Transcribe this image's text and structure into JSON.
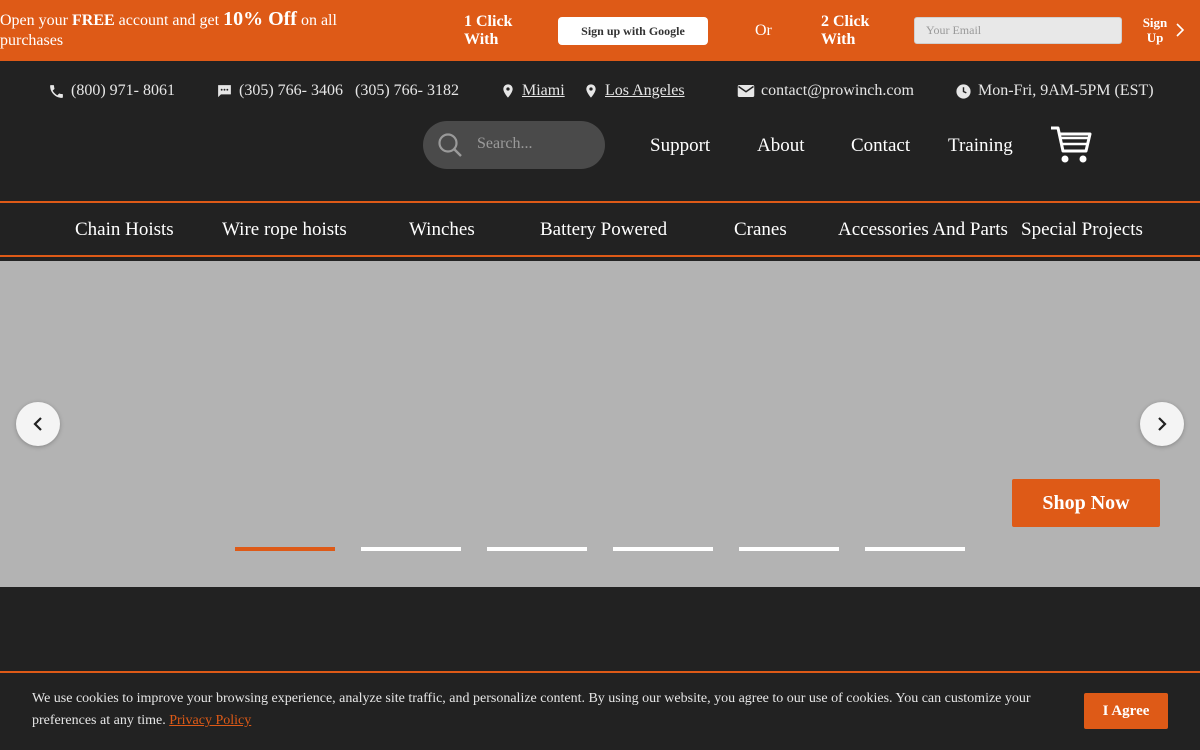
{
  "promo": {
    "text_prefix": "Open your ",
    "text_free": "FREE",
    "text_mid": " account and get ",
    "text_offer": "10% Off",
    "text_suffix": " on all purchases",
    "one_click": "1 Click With",
    "google_button": "Sign up with Google",
    "or": "Or",
    "two_click": "2 Click With",
    "email_placeholder": "Your Email",
    "signup": "Sign Up"
  },
  "contact": {
    "phone": "(800) 971- 8061",
    "chat_1": "(305) 766- 3406",
    "chat_2": "(305) 766- 3182",
    "location_1": "Miami",
    "location_2": "Los Angeles",
    "email": "contact@prowinch.com",
    "hours": "Mon-Fri, 9AM-5PM (EST)"
  },
  "header": {
    "search_placeholder": "Search...",
    "nav": [
      "Support",
      "About",
      "Contact",
      "Training"
    ]
  },
  "categories": [
    "Chain Hoists",
    "Wire rope hoists",
    "Winches",
    "Battery Powered",
    "Cranes",
    "Accessories And Parts",
    "Special Projects"
  ],
  "hero": {
    "shop_now": "Shop Now",
    "slide_count": 6,
    "active_slide": 1
  },
  "cookie": {
    "text": "We use cookies to improve your browsing experience, analyze site traffic, and personalize content. By using our website, you agree to our use of cookies. You can customize your preferences at any time. ",
    "link": "Privacy Policy",
    "agree": "I Agree"
  },
  "colors": {
    "accent": "#de5a17",
    "background": "#222222",
    "hero": "#b3b3b3"
  }
}
